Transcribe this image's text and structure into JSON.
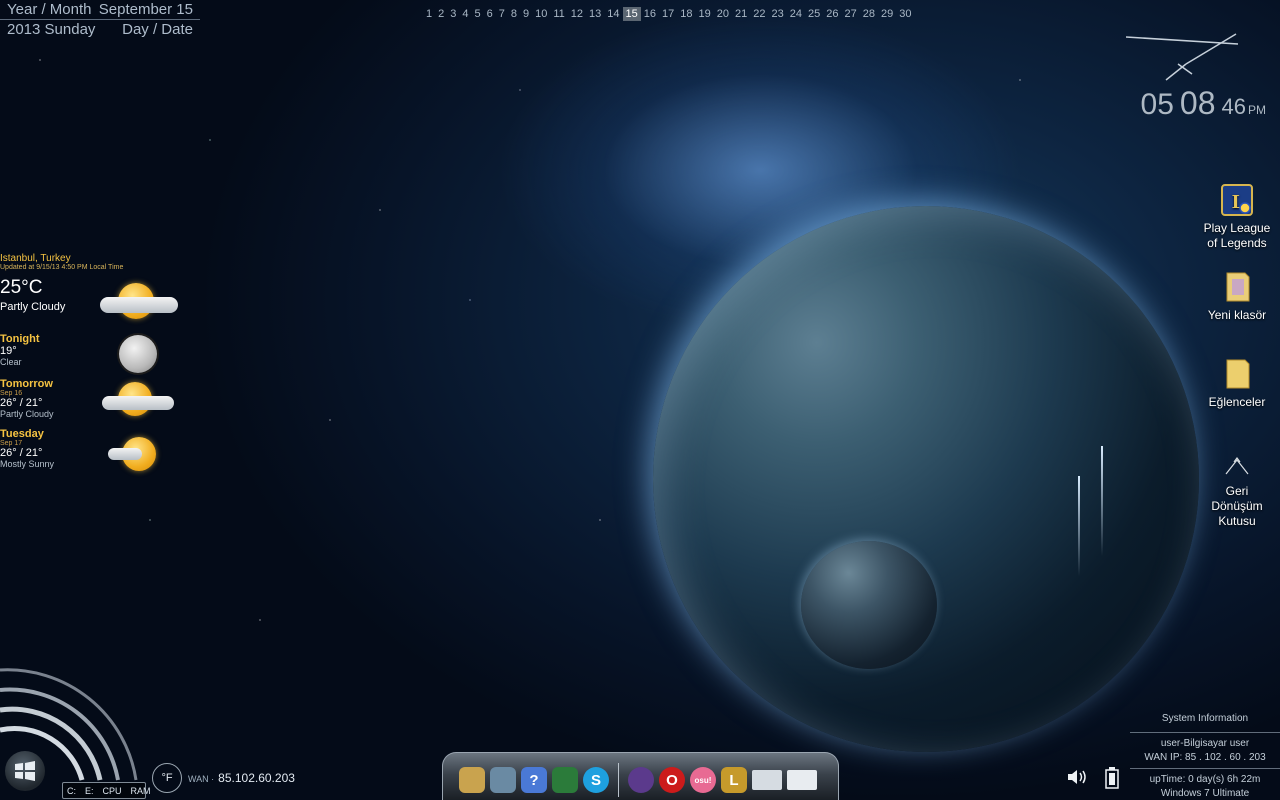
{
  "date_widget": {
    "row1_left": "Year / Month",
    "row1_right": "September 15",
    "row2_left": "2013 Sunday",
    "row2_right": "Day / Date"
  },
  "calendar": {
    "days": [
      "1",
      "2",
      "3",
      "4",
      "5",
      "6",
      "7",
      "8",
      "9",
      "10",
      "11",
      "12",
      "13",
      "14",
      "15",
      "16",
      "17",
      "18",
      "19",
      "20",
      "21",
      "22",
      "23",
      "24",
      "25",
      "26",
      "27",
      "28",
      "29",
      "30"
    ],
    "today": "15"
  },
  "clock": {
    "hours": "05",
    "minutes": "08",
    "seconds": "46",
    "ampm": "PM"
  },
  "desktop_icons": [
    {
      "label_line1": "Play League",
      "label_line2": "of Legends",
      "icon": "league-of-legends-icon"
    },
    {
      "label_line1": "Yeni klasör",
      "label_line2": "",
      "icon": "folder-icon"
    },
    {
      "label_line1": "Eğlenceler",
      "label_line2": "",
      "icon": "folder-icon"
    },
    {
      "label_line1": "Geri",
      "label_line2": "Dönüşüm",
      "label_line3": "Kutusu",
      "icon": "recycle-bin-icon"
    }
  ],
  "weather": {
    "location": "Istanbul, Turkey",
    "updated": "Updated at 9/15/13 4:50 PM Local Time",
    "current": {
      "temp": "25°C",
      "condition": "Partly Cloudy",
      "icon": "partly-cloudy-icon"
    },
    "forecast": [
      {
        "name": "Tonight",
        "date": "",
        "temp": "19°",
        "condition": "Clear",
        "icon": "moon-icon"
      },
      {
        "name": "Tomorrow",
        "date": "Sep 16",
        "temp": "26° / 21°",
        "condition": "Partly Cloudy",
        "icon": "partly-cloudy-icon"
      },
      {
        "name": "Tuesday",
        "date": "Sep 17",
        "temp": "26° / 21°",
        "condition": "Mostly Sunny",
        "icon": "mostly-sunny-icon"
      }
    ]
  },
  "meters": {
    "labels": [
      "C:",
      "E:",
      "CPU",
      "RAM"
    ]
  },
  "temp_unit": "°F",
  "wan": {
    "label": "WAN ·",
    "ip": "85.102.60.203"
  },
  "dock": {
    "items": [
      {
        "name": "paint-app-icon",
        "color": "#c9a34e"
      },
      {
        "name": "calculator-icon",
        "color": "#6a8aa3"
      },
      {
        "name": "help-icon",
        "color": "#4a79d6",
        "glyph": "?"
      },
      {
        "name": "computer-icon",
        "color": "#2b7b3a"
      },
      {
        "name": "skype-icon",
        "color": "#1ea0df",
        "glyph": "S"
      },
      {
        "name": "bittorrent-icon",
        "color": "#5b3a8c"
      },
      {
        "name": "opera-icon",
        "color": "#cc1b1b",
        "glyph": "O"
      },
      {
        "name": "osu-icon",
        "color": "#e86a93",
        "glyph": "osu!"
      },
      {
        "name": "league-of-legends-icon",
        "color": "#c69a2b",
        "glyph": "L"
      },
      {
        "name": "window-preview-icon",
        "color": "#d6dce2"
      },
      {
        "name": "window-preview-icon",
        "color": "#e8ecf0"
      }
    ]
  },
  "sysinfo": {
    "title": "System Information",
    "user": "user-Bilgisayar  user",
    "wan": "WAN IP: 85 . 102 . 60 . 203",
    "uptime": "upTime: 0 day(s) 6h 22m",
    "os": "Windows 7 Ultimate"
  }
}
